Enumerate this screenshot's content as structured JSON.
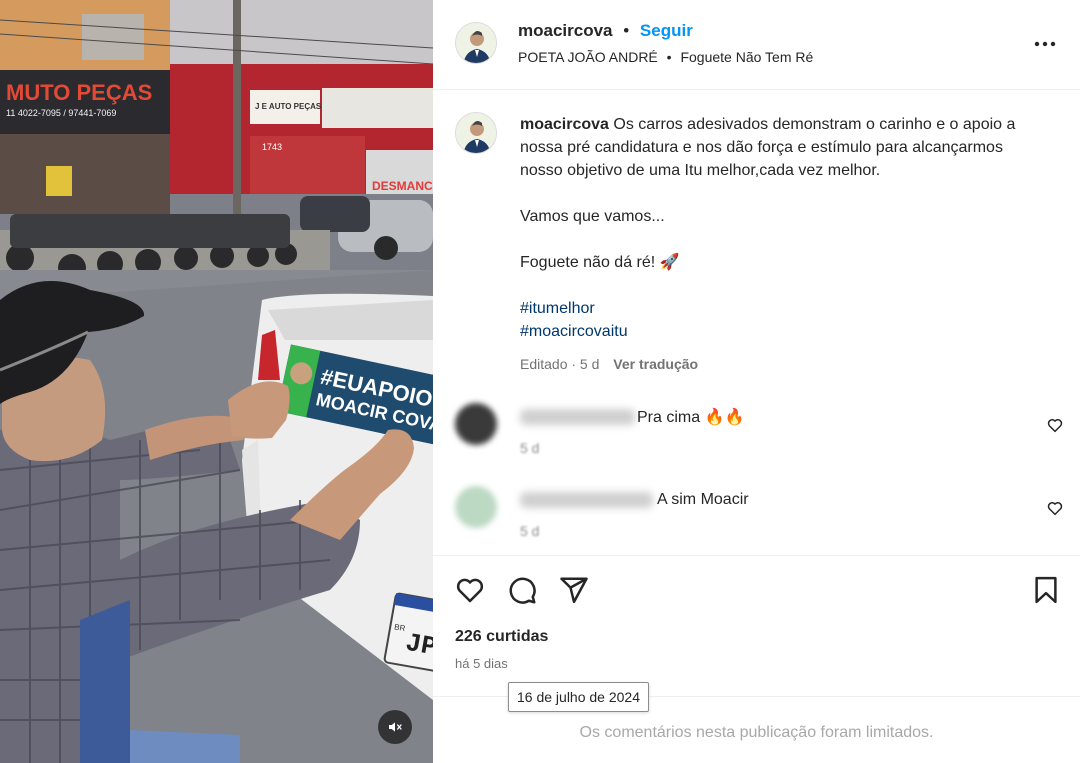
{
  "post": {
    "username": "moacircova",
    "follow_label": "Seguir",
    "location": "POETA JOÃO ANDRÉ",
    "audio": "Foguete Não Tem Ré",
    "separator": "•"
  },
  "caption": {
    "username": "moacircova",
    "text": "Os carros adesivados demonstram o carinho e o apoio a nossa pré candidatura e nos dão força e estímulo para alcançarmos nosso objetivo de uma Itu melhor,cada vez melhor.",
    "line2": "Vamos que vamos...",
    "line3": "Foguete não dá ré! 🚀",
    "hashtags": [
      "#itumelhor",
      "#moacircovaitu"
    ],
    "edited": "Editado · 5 d",
    "translate_label": "Ver tradução"
  },
  "comments": [
    {
      "text": "Pra cima 🔥🔥",
      "time": "5 d",
      "avatar_color": "#3a3a3a"
    },
    {
      "text": "A sim Moacir",
      "time": "5 d",
      "avatar_color": "#bcd9c3"
    }
  ],
  "engagement": {
    "likes": "226 curtidas",
    "posted_ago": "há 5 dias",
    "tooltip_date": "16 de julho de 2024"
  },
  "footer": {
    "limited_comments": "Os comentários nesta publicação foram limitados."
  },
  "media": {
    "sticker_line1": "#EUAPOIO",
    "sticker_line2": "MOACIR COVA",
    "shop_sign": "MUTO PEÇAS",
    "shop_phone": "11 4022-7095 / 97441-7069",
    "shop_sign2": "J E AUTO PEÇAS",
    "shop_number": "1743",
    "shop_sign3": "DESMANCHE",
    "plate": "JP",
    "plate_country": "BR"
  },
  "colors": {
    "accent": "#0095f6",
    "hashtag": "#00376b",
    "muted": "#737373"
  }
}
